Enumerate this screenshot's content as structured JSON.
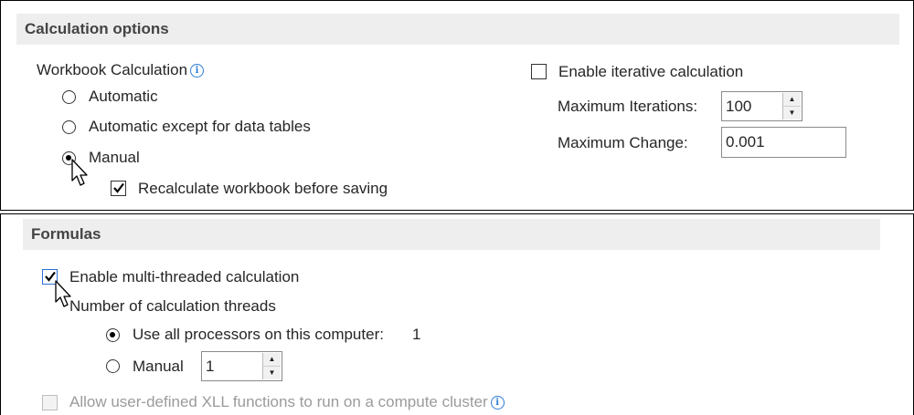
{
  "calc": {
    "header": "Calculation options",
    "workbook_calc_label": "Workbook Calculation",
    "options": [
      {
        "label": "Automatic",
        "selected": false
      },
      {
        "label": "Automatic except for data tables",
        "selected": false
      },
      {
        "label": "Manual",
        "selected": true
      }
    ],
    "recalc_before_saving": {
      "label": "Recalculate workbook before saving",
      "checked": true
    },
    "iterative": {
      "label": "Enable iterative calculation",
      "checked": false
    },
    "max_iterations": {
      "label": "Maximum Iterations:",
      "value": "100"
    },
    "max_change": {
      "label": "Maximum Change:",
      "value": "0.001"
    }
  },
  "formulas": {
    "header": "Formulas",
    "multithreaded": {
      "label": "Enable multi-threaded calculation",
      "checked": true
    },
    "threads_label": "Number of calculation threads",
    "use_all": {
      "label": "Use all processors on this computer:",
      "count": "1",
      "selected": true
    },
    "manual": {
      "label": "Manual",
      "value": "1",
      "selected": false
    },
    "xll": {
      "label": "Allow user-defined XLL functions to run on a compute cluster",
      "checked": false
    }
  },
  "colors": {
    "accent": "#2b6fd6",
    "header_bg": "#eeeeee"
  },
  "icons": [
    "info-icon",
    "checkmark-icon",
    "spin-up-icon",
    "spin-down-icon",
    "mouse-pointer-icon"
  ]
}
